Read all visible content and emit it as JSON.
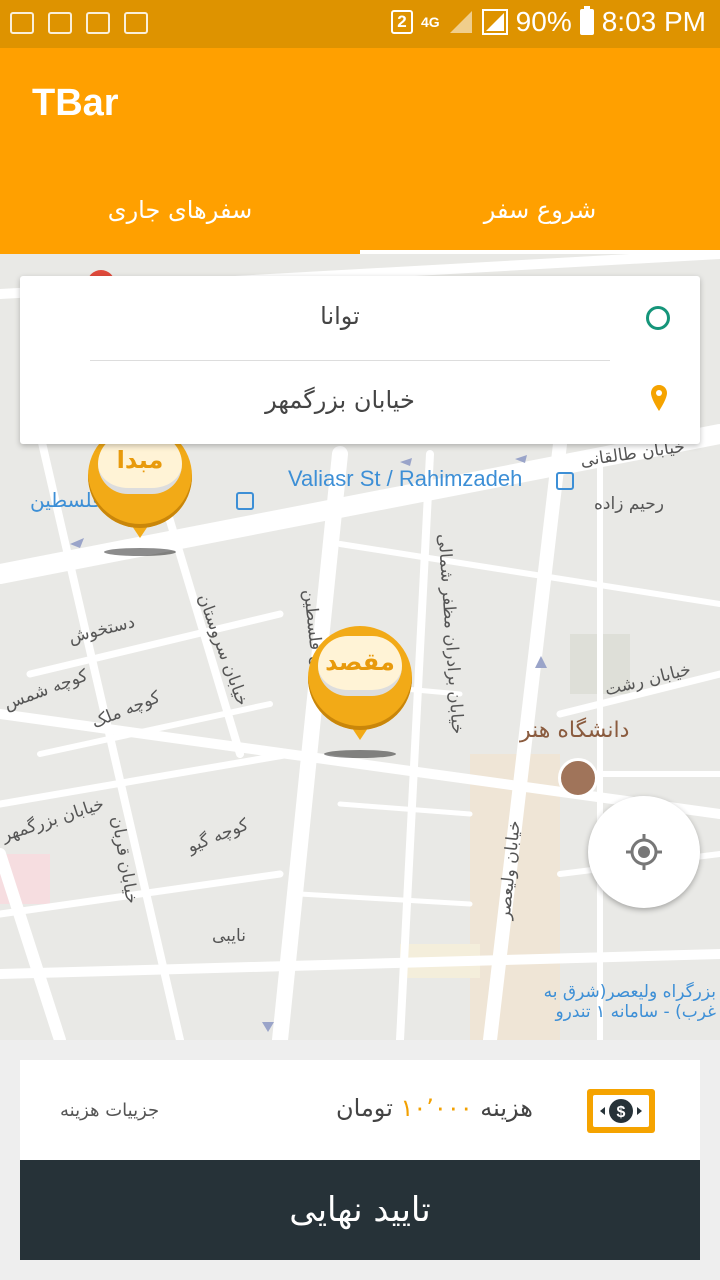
{
  "status_bar": {
    "notification_badge": "2",
    "network": "4G",
    "battery": "90%",
    "time": "8:03 PM"
  },
  "app_bar": {
    "title": "TBar",
    "tabs": [
      {
        "label": "سفرهای جاری",
        "selected": false
      },
      {
        "label": "شروع سفر",
        "selected": true
      }
    ]
  },
  "addresses": {
    "origin": "توانا",
    "destination": "خیابان بزرگمهر"
  },
  "map": {
    "labels": {
      "valiasr": "Valiasr St / Rahimzadeh",
      "palestine": "ایستگاه فلسطین",
      "taleghani": "خیابان طالقانی",
      "rahimzadeh": "رحیم زاده",
      "dastkhosh": "دستخوش",
      "shams": "کوچه شمس",
      "malek": "کوچه ملک",
      "sarv": "خیابان سروستان",
      "felestin": "خیابان فلسطین",
      "mozaffar": "خیابان برادران مظفر شمالی",
      "rasht": "خیابان رشت",
      "honar": "دانشگاه هنر",
      "bozorgmehr": "خیابان بزرگمهر",
      "ghorban": "خیابان قربان",
      "giv": "کوچه گیو",
      "naie": "نایبی",
      "valiasr_street": "خیابان ولیعصر",
      "valiasr_bus": "بزرگراه ولیعصر(شرق به غرب) - سامانه ۱ تندرو"
    },
    "markers": {
      "origin_label": "مبدا",
      "destination_label": "مقصد"
    }
  },
  "cost": {
    "label": "هزینه",
    "amount": "۱۰٬۰۰۰",
    "currency": "تومان",
    "details_link": "جزییات هزینه"
  },
  "confirm_button": "تایید نهایی",
  "colors": {
    "primary": "#ffa000",
    "status_bar": "#de9300",
    "dark_button": "#263238",
    "origin_green": "#15957a"
  }
}
